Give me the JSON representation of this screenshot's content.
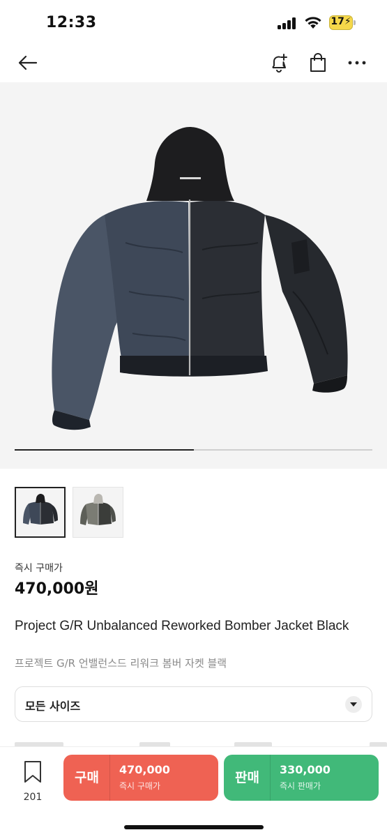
{
  "status_bar": {
    "time": "12:33",
    "battery": "17",
    "icons": [
      "signal-icon",
      "wifi-icon",
      "battery-icon"
    ]
  },
  "nav": {
    "icons": [
      "arrow-left-icon",
      "bell-plus-icon",
      "shopping-bag-icon",
      "more-horizontal-icon"
    ]
  },
  "gallery": {
    "slide_progress": 0.5,
    "thumbnails": [
      "black-bomber-jacket",
      "grey-bomber-jacket"
    ]
  },
  "price": {
    "label": "즉시 구매가",
    "value": "470,000원"
  },
  "product": {
    "name_en": "Project G/R Unbalanced Reworked Bomber Jacket Black",
    "name_ko": "프로젝트 G/R 언밸런스드 리워크 봄버 자켓 블랙"
  },
  "size_selector": {
    "label": "모든 사이즈"
  },
  "bottom_bar": {
    "wish_count": "201",
    "buy": {
      "label": "구매",
      "price": "470,000",
      "sub": "즉시 구매가"
    },
    "sell": {
      "label": "판매",
      "price": "330,000",
      "sub": "즉시 판매가"
    }
  },
  "colors": {
    "buy": "#ef6253",
    "sell": "#41b979",
    "battery": "#f6d84a",
    "image_bg": "#f4f4f4"
  }
}
